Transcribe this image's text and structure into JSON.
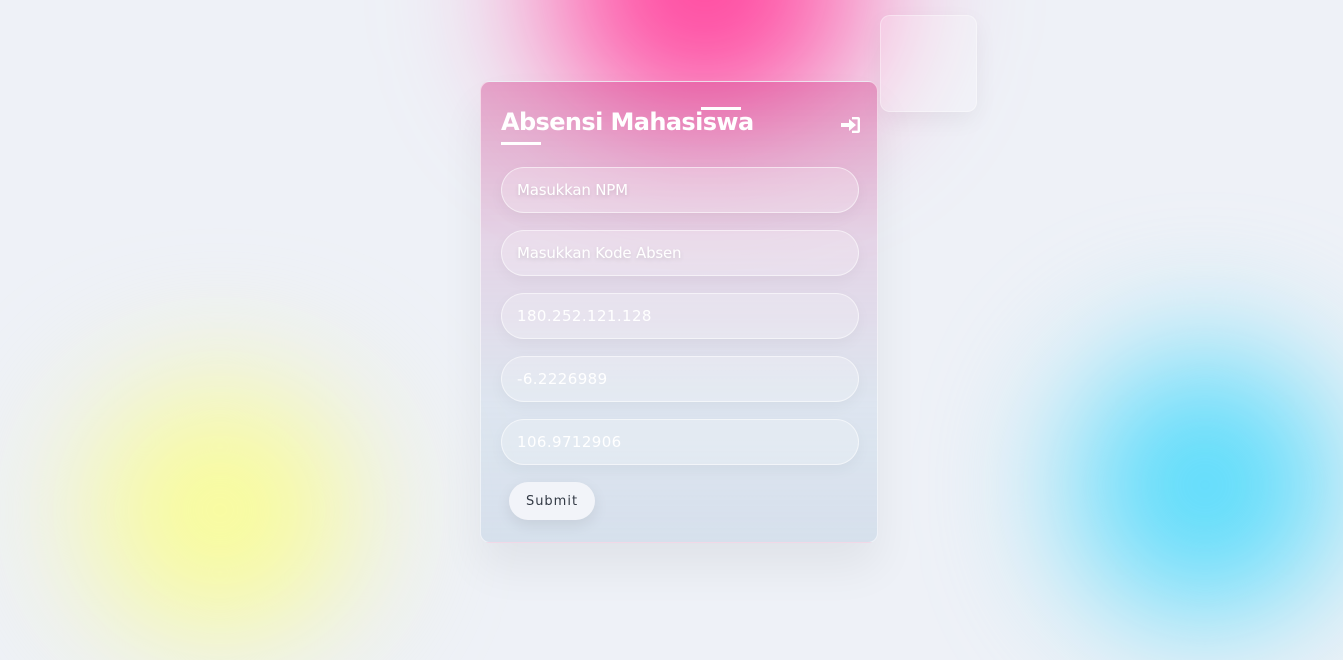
{
  "form": {
    "title": "Absensi Mahasiswa",
    "login_icon": "sign-in-icon",
    "fields": [
      {
        "placeholder": "Masukkan NPM",
        "value": ""
      },
      {
        "placeholder": "Masukkan Kode Absen",
        "value": ""
      },
      {
        "placeholder": "",
        "value": "180.252.121.128"
      },
      {
        "placeholder": "",
        "value": "-6.2226989"
      },
      {
        "placeholder": "",
        "value": "106.9712906"
      }
    ],
    "submit_label": "Submit"
  },
  "colors": {
    "pink_blob": "#ff3d9a",
    "yellow_blob": "#f9fc99",
    "cyan_blob": "#55dcfb",
    "background": "#eef1f7",
    "text_white": "#ffffff",
    "button_bg": "#f2f4f9"
  }
}
